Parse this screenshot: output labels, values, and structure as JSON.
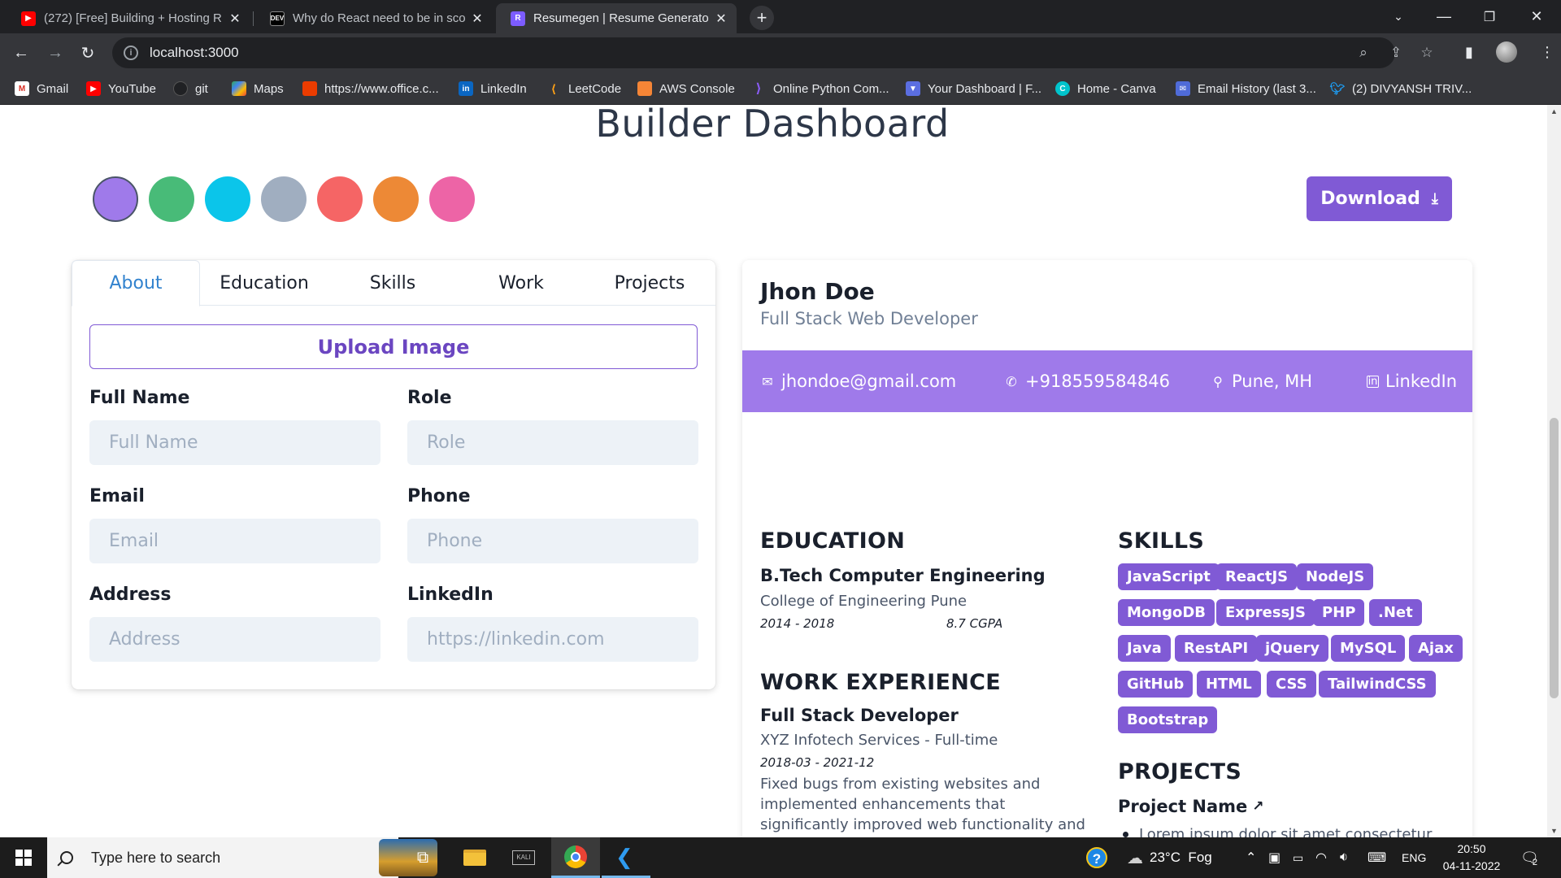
{
  "browser": {
    "tabs": [
      {
        "title": "(272) [Free] Building + Hosting R",
        "favicon": "youtube-icon",
        "active": false
      },
      {
        "title": "Why do React need to be in scop",
        "favicon": "dev-icon",
        "active": false
      },
      {
        "title": "Resumegen | Resume Generator",
        "favicon": "resumegen-icon",
        "active": true
      }
    ],
    "address": "localhost:3000",
    "bookmarks": [
      {
        "label": "Gmail",
        "icon": "gmail-icon"
      },
      {
        "label": "YouTube",
        "icon": "youtube-icon"
      },
      {
        "label": "git",
        "icon": "github-icon"
      },
      {
        "label": "Maps",
        "icon": "maps-icon"
      },
      {
        "label": "https://www.office.c...",
        "icon": "office-icon"
      },
      {
        "label": "LinkedIn",
        "icon": "linkedin-icon"
      },
      {
        "label": "LeetCode",
        "icon": "leetcode-icon"
      },
      {
        "label": "AWS Console",
        "icon": "aws-icon"
      },
      {
        "label": "Online Python Com...",
        "icon": "python-icon"
      },
      {
        "label": "Your Dashboard | F...",
        "icon": "dashboard-icon"
      },
      {
        "label": "Home - Canva",
        "icon": "canva-icon"
      },
      {
        "label": "Email History (last 3...",
        "icon": "email-icon"
      },
      {
        "label": "(2) DIVYANSH TRIV...",
        "icon": "twitter-icon"
      }
    ]
  },
  "page": {
    "title": "Builder Dashboard",
    "download_label": "Download",
    "theme_colors": [
      "#9f7aea",
      "#48bb78",
      "#0bc5ea",
      "#a0aec0",
      "#f56565",
      "#ed8936",
      "#ed64a6"
    ],
    "form": {
      "tabs": [
        "About",
        "Education",
        "Skills",
        "Work",
        "Projects"
      ],
      "upload_label": "Upload Image",
      "fields": {
        "full_name": {
          "label": "Full Name",
          "placeholder": "Full Name",
          "value": ""
        },
        "role": {
          "label": "Role",
          "placeholder": "Role",
          "value": ""
        },
        "email": {
          "label": "Email",
          "placeholder": "Email",
          "value": ""
        },
        "phone": {
          "label": "Phone",
          "placeholder": "Phone",
          "value": ""
        },
        "address": {
          "label": "Address",
          "placeholder": "Address",
          "value": ""
        },
        "linkedin": {
          "label": "LinkedIn",
          "placeholder": "https://linkedin.com",
          "value": ""
        }
      }
    },
    "resume": {
      "name": "Jhon Doe",
      "role": "Full Stack Web Developer",
      "contact": {
        "email": "jhondoe@gmail.com",
        "phone": "+918559584846",
        "location": "Pune, MH",
        "linkedin": "LinkedIn"
      },
      "education": {
        "heading": "EDUCATION",
        "degree": "B.Tech Computer Engineering",
        "school": "College of Engineering Pune",
        "years": "2014 - 2018",
        "grade": "8.7 CGPA"
      },
      "work": {
        "heading": "WORK EXPERIENCE",
        "title": "Full Stack Developer",
        "company": "XYZ Infotech Services - Full-time",
        "dates": "2018-03 - 2021-12",
        "description": "Fixed bugs from existing websites and implemented enhancements that significantly improved web functionality and speed."
      },
      "skills": {
        "heading": "SKILLS",
        "items": [
          "JavaScript",
          "ReactJS",
          "NodeJS",
          "MongoDB",
          "ExpressJS",
          "PHP",
          ".Net",
          "Java",
          "RestAPI",
          "jQuery",
          "MySQL",
          "Ajax",
          "GitHub",
          "HTML",
          "CSS",
          "TailwindCSS",
          "Bootstrap"
        ]
      },
      "projects": {
        "heading": "PROJECTS",
        "name": "Project Name",
        "bullet": "Lorem ipsum dolor sit amet consectetur adipisicing."
      }
    }
  },
  "taskbar": {
    "search_placeholder": "Type here to search",
    "weather": "23°C  Fog",
    "language": "ENG",
    "time": "20:50",
    "date": "04-11-2022",
    "notifications": "2"
  }
}
